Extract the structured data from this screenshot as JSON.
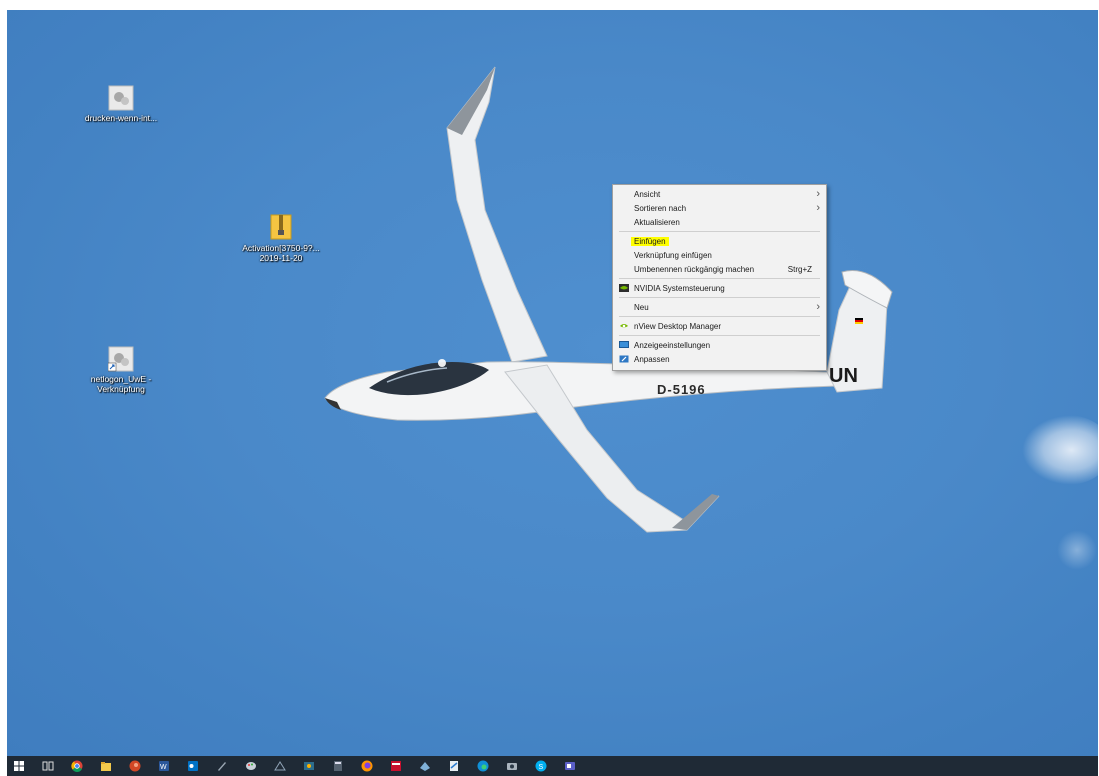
{
  "desktop_icons": [
    {
      "label": "drucken-wenn-int..."
    },
    {
      "label": "Activation[3750-9?...",
      "label2": "2019-11-20"
    },
    {
      "label": "netlogon_UwE -",
      "label2": "Verknüpfung"
    }
  ],
  "glider": {
    "registration": "D-5196",
    "tail_marking": "UN"
  },
  "context_menu": {
    "items": [
      {
        "label": "Ansicht",
        "submenu": true
      },
      {
        "label": "Sortieren nach",
        "submenu": true
      },
      {
        "label": "Aktualisieren"
      },
      {
        "label": "Einfügen",
        "highlighted": true
      },
      {
        "label": "Verknüpfung einfügen"
      },
      {
        "label": "Umbenennen rückgängig machen",
        "shortcut": "Strg+Z"
      },
      {
        "label": "NVIDIA Systemsteuerung",
        "icon": "nvidia-icon"
      },
      {
        "label": "Neu",
        "submenu": true
      },
      {
        "label": "nView Desktop Manager",
        "icon": "nview-icon"
      },
      {
        "label": "Anzeigeeinstellungen",
        "icon": "display-icon"
      },
      {
        "label": "Anpassen",
        "icon": "personalize-icon"
      }
    ],
    "highlight_color": "#ffff00"
  },
  "taskbar": {
    "icons": [
      "windows-start-icon",
      "task-view-icon",
      "chrome-icon",
      "file-explorer-icon",
      "powerpoint-icon",
      "word-icon",
      "outlook-icon",
      "pen-tool-icon",
      "paint-icon",
      "cad-icon",
      "media-icon",
      "calculator-icon",
      "firefox-icon",
      "jeti-icon",
      "app-icon",
      "pdf-icon",
      "edge-icon",
      "camera-icon",
      "skype-icon",
      "teams-icon"
    ]
  }
}
